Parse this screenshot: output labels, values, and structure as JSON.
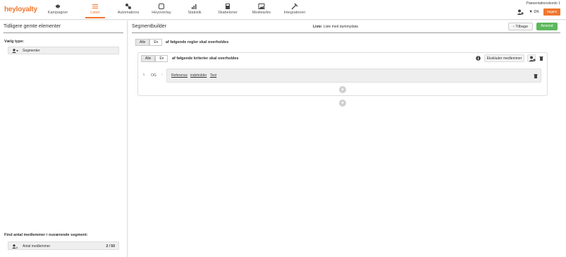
{
  "app": {
    "logo": "heyloyalty"
  },
  "nav": {
    "items": [
      {
        "label": "Kampagner",
        "icon": "megaphone-icon",
        "active": false
      },
      {
        "label": "Lister",
        "icon": "list-icon",
        "active": true
      },
      {
        "label": "Automations",
        "icon": "automation-icon",
        "active": false
      },
      {
        "label": "Heyoverlay",
        "icon": "overlay-icon",
        "active": false
      },
      {
        "label": "Statistik",
        "icon": "chart-icon",
        "active": false
      },
      {
        "label": "Skabeloner",
        "icon": "template-icon",
        "active": false
      },
      {
        "label": "Mediearkiv",
        "icon": "image-icon",
        "active": false
      },
      {
        "label": "Integrationer",
        "icon": "plug-icon",
        "active": false
      }
    ],
    "account": "Præsentationskonto 1",
    "language": "DK",
    "save_label": "Sagem"
  },
  "left": {
    "title": "Tidligere gemte elementer",
    "type_label": "Vælg type:",
    "type_value": "Segmenter",
    "find_label": "Find antal medlemmer i nuværende segment:",
    "count_label": "Antal medlemmer",
    "count_value": "2 / 50"
  },
  "main": {
    "title": "Segmentbuilder",
    "list_prefix": "Liste:",
    "list_name": "Liste med dummydata",
    "back_label": "Tilbage",
    "apply_label": "Anvend",
    "outer_toggle": [
      "Alle",
      "Én"
    ],
    "outer_text": "af følgende regler skal overholdes",
    "inner_toggle": [
      "Alle",
      "Én"
    ],
    "inner_text": "af følgende kriterier skal overholdes",
    "exclude_label": "Ekskluder medlemmer",
    "operator": "OG",
    "crumbs": [
      "Reference",
      "indeholder",
      "Test"
    ]
  },
  "colors": {
    "accent": "#f0772e",
    "success": "#5cb85c"
  }
}
